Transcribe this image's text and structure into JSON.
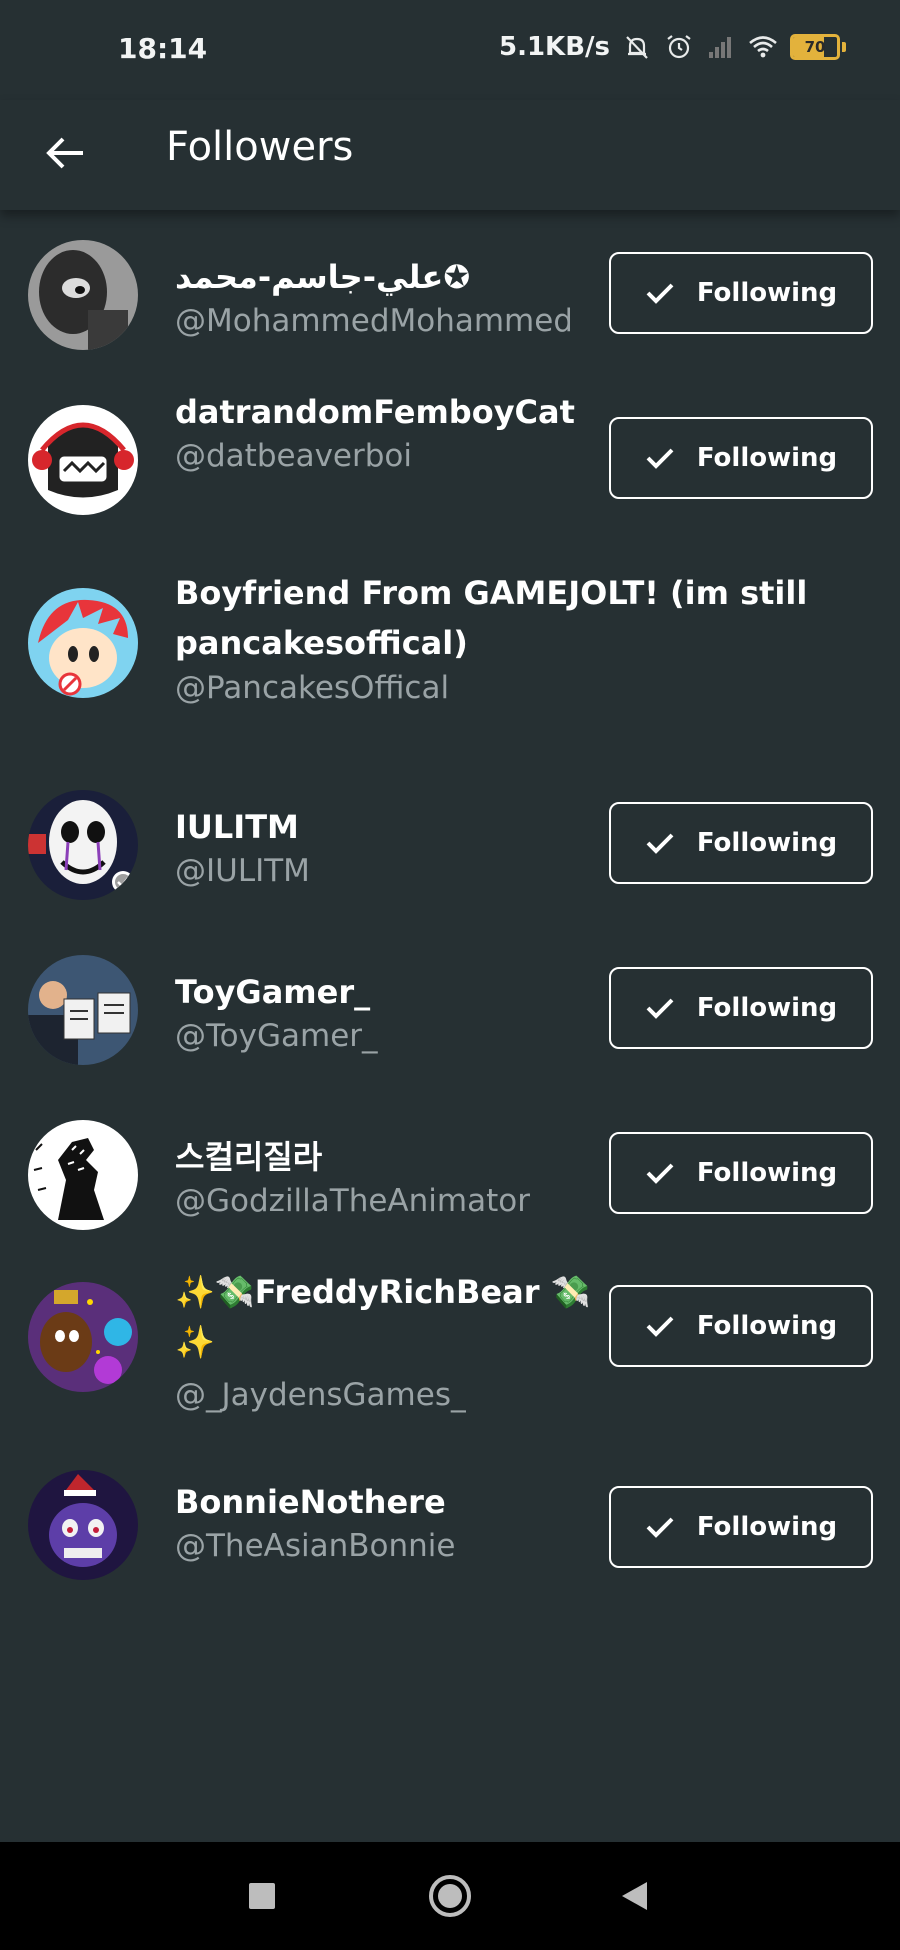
{
  "status_bar": {
    "time": "18:14",
    "network_speed": "5.1KB/s",
    "battery_level": "70",
    "battery_color": "#e3b23c"
  },
  "toolbar": {
    "title": "Followers",
    "back_icon": "arrow-left-icon"
  },
  "colors": {
    "background": "#263033",
    "handle_text": "#9aa3a6",
    "button_border": "#ffffff"
  },
  "followers": [
    {
      "name": "علي-جاسم-محمد✪",
      "handle": "@MohammedMohammed",
      "button": "Following",
      "avatar_color": "#555555"
    },
    {
      "name": "datrandomFemboyCat",
      "handle": "@datbeaverboi",
      "button": "Following",
      "avatar_color": "#ffffff"
    },
    {
      "name": "Boyfriend From GAMEJOLT! (im still pancakesoffical)",
      "handle": "@PancakesOffical",
      "button": "",
      "avatar_color": "#7fd3f0"
    },
    {
      "name": "IULITM",
      "handle": "@IULITM",
      "button": "Following",
      "avatar_color": "#1a1f3a",
      "verified": true
    },
    {
      "name": "ToyGamer_",
      "handle": "@ToyGamer_",
      "button": "Following",
      "avatar_color": "#3d5673"
    },
    {
      "name": "스컬리질라",
      "handle": "@GodzillaTheAnimator",
      "button": "Following",
      "avatar_color": "#ffffff"
    },
    {
      "name": "✨💸FreddyRichBear 💸✨",
      "handle": "@_JaydensGames_",
      "button": "Following",
      "avatar_color": "#5a2f7a"
    },
    {
      "name": "BonnieNothere",
      "handle": "@TheAsianBonnie",
      "button": "Following",
      "avatar_color": "#3a2a6b"
    }
  ],
  "nav_bar": {
    "recents_icon": "square-icon",
    "home_icon": "circle-icon",
    "back_icon": "triangle-back-icon"
  }
}
